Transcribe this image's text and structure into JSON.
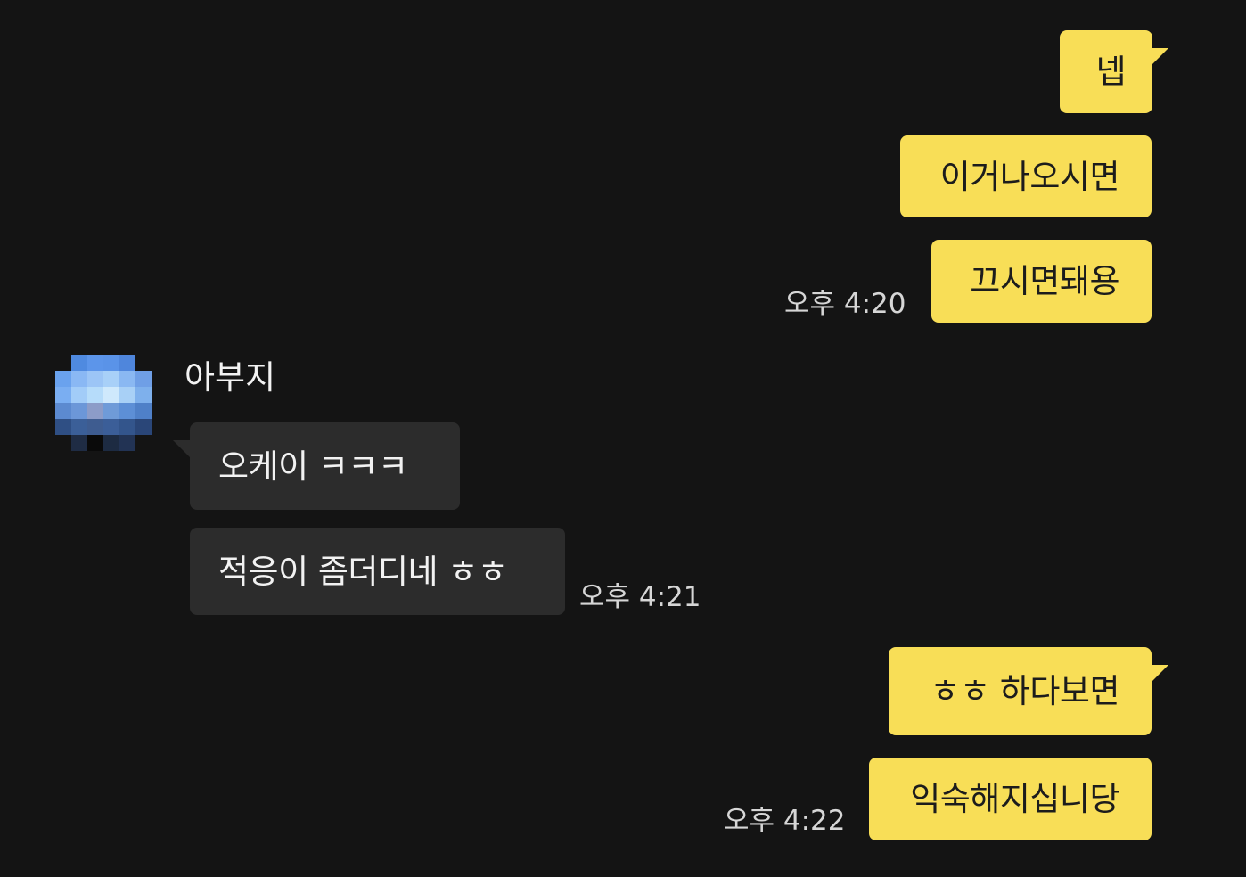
{
  "chat": {
    "messages_out_1": [
      "넵",
      "이거나오시면",
      "끄시면돼용"
    ],
    "time_1": "오후 4:20",
    "sender_name": "아부지",
    "messages_in": [
      "오케이 ㅋㅋㅋ",
      "적응이 좀더디네 ㅎㅎ"
    ],
    "time_2": "오후 4:21",
    "messages_out_2": [
      "ㅎㅎ 하다보면",
      "익숙해지십니당"
    ],
    "time_3": "오후 4:22"
  },
  "colors": {
    "background": "#141414",
    "my_bubble": "#f8de57",
    "their_bubble": "#2c2c2c"
  }
}
